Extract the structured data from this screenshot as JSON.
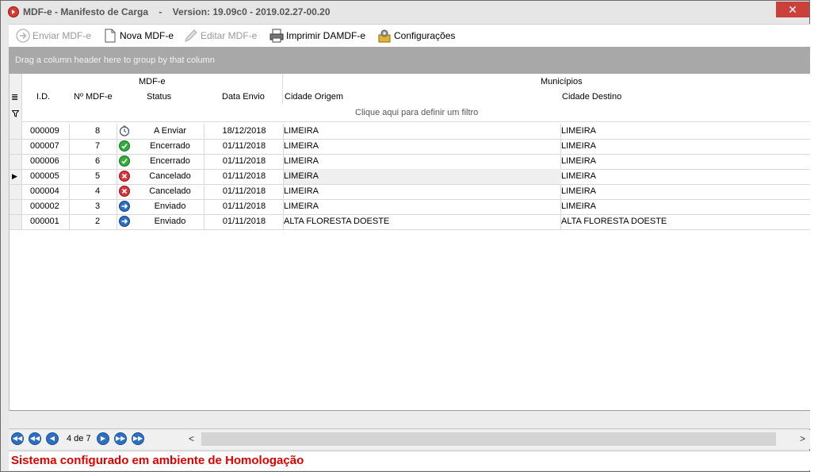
{
  "window": {
    "title": "MDF-e - Manifesto de Carga    -    Version: 19.09c0 - 2019.02.27-00.20",
    "close_label": "✕"
  },
  "toolbar": {
    "buttons": [
      {
        "label": "Enviar MDF-e",
        "icon": "send-icon",
        "enabled": false
      },
      {
        "label": "Nova MDF-e",
        "icon": "new-document-icon",
        "enabled": true
      },
      {
        "label": "Editar MDF-e",
        "icon": "edit-pencil-icon",
        "enabled": false
      },
      {
        "label": "Imprimir DAMDF-e",
        "icon": "printer-icon",
        "enabled": true
      },
      {
        "label": "Configurações",
        "icon": "settings-tools-icon",
        "enabled": true
      }
    ]
  },
  "group_panel": {
    "text": "Drag a column header here to group by that column"
  },
  "grid": {
    "bands": {
      "mdfe": "MDF-e",
      "municipios": "Municípios"
    },
    "columns": {
      "id": "I.D.",
      "numero": "Nº MDF-e",
      "status": "Status",
      "data_envio": "Data Envio",
      "origem": "Cidade Origem",
      "destino": "Cidade Destino"
    },
    "filter_text": "Clique aqui para definir um filtro",
    "rows": [
      {
        "id": "000009",
        "numero": "8",
        "status": "A Enviar",
        "status_icon": "clock-icon",
        "data": "18/12/2018",
        "origem": "LIMEIRA",
        "destino": "LIMEIRA"
      },
      {
        "id": "000007",
        "numero": "7",
        "status": "Encerrado",
        "status_icon": "green-check-icon",
        "data": "01/11/2018",
        "origem": "LIMEIRA",
        "destino": "LIMEIRA"
      },
      {
        "id": "000006",
        "numero": "6",
        "status": "Encerrado",
        "status_icon": "green-check-icon",
        "data": "01/11/2018",
        "origem": "LIMEIRA",
        "destino": "LIMEIRA"
      },
      {
        "id": "000005",
        "numero": "5",
        "status": "Cancelado",
        "status_icon": "red-x-icon",
        "data": "01/11/2018",
        "origem": "LIMEIRA",
        "destino": "LIMEIRA"
      },
      {
        "id": "000004",
        "numero": "4",
        "status": "Cancelado",
        "status_icon": "red-x-icon",
        "data": "01/11/2018",
        "origem": "LIMEIRA",
        "destino": "LIMEIRA"
      },
      {
        "id": "000002",
        "numero": "3",
        "status": "Enviado",
        "status_icon": "blue-arrow-icon",
        "data": "01/11/2018",
        "origem": "LIMEIRA",
        "destino": "LIMEIRA"
      },
      {
        "id": "000001",
        "numero": "2",
        "status": "Enviado",
        "status_icon": "blue-arrow-icon",
        "data": "01/11/2018",
        "origem": "ALTA FLORESTA DOESTE",
        "destino": "ALTA FLORESTA DOESTE"
      }
    ],
    "selected_row": 3
  },
  "navigator": {
    "page_text": "4 de 7",
    "scroll_left": "<",
    "scroll_right": ">"
  },
  "status": {
    "message": "Sistema configurado em ambiente de Homologação"
  },
  "colors": {
    "status_message": "#e00000",
    "group_panel": "#a8a8a8",
    "close_button": "#c9413a"
  }
}
